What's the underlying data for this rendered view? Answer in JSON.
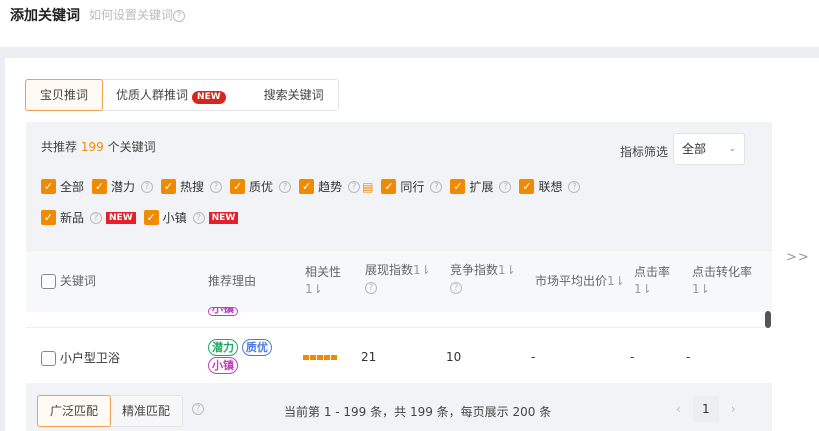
{
  "header": {
    "title": "添加关键词",
    "help_link": "如何设置关键词"
  },
  "tabs": [
    {
      "label": "宝贝推词",
      "active": true
    },
    {
      "label": "优质人群推词",
      "badge": "NEW"
    },
    {
      "label": "搜索关键词"
    }
  ],
  "filter": {
    "count_prefix": "共推荐",
    "count": "199",
    "count_suffix": "个关键词",
    "filter_label": "指标筛选",
    "filter_value": "全部",
    "checkboxes_row1": [
      {
        "label": "全部"
      },
      {
        "label": "潜力"
      },
      {
        "label": "热搜"
      },
      {
        "label": "质优"
      },
      {
        "label": "趋势"
      },
      {
        "label": "同行"
      },
      {
        "label": "扩展"
      },
      {
        "label": "联想"
      }
    ],
    "checkboxes_row2": [
      {
        "label": "新品",
        "badge": "NEW"
      },
      {
        "label": "小镇",
        "badge": "NEW"
      }
    ]
  },
  "table": {
    "columns": [
      "关键词",
      "推荐理由",
      "相关性",
      "展现指数",
      "竞争指数",
      "市场平均出价",
      "点击率",
      "点击转化率"
    ],
    "partial_tag": "小镇",
    "rows": [
      {
        "keyword": "小户型卫浴",
        "tags": [
          "潜力",
          "质优",
          "小镇"
        ],
        "relevance": 5,
        "impression": "21",
        "competition": "10",
        "avg_bid": "-",
        "ctr": "-",
        "cvr": "-"
      }
    ]
  },
  "footer": {
    "match_types": [
      "广泛匹配",
      "精准匹配"
    ],
    "page_info": "当前第 1 - 199 条，共 199 条，每页展示 200 条",
    "current_page": "1"
  },
  "expand": ">>"
}
